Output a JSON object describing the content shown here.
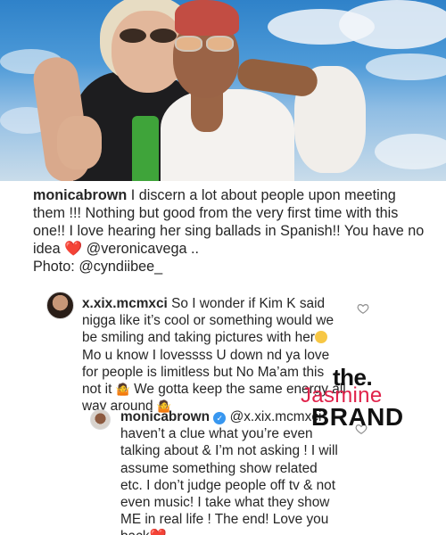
{
  "post": {
    "username": "monicabrown",
    "caption_text": " I discern a lot about people upon meeting them !!! Nothing but good from the very first time with this one!! I love hearing her sing ballads in Spanish!! You have no idea ",
    "caption_mention": "@veronicavega",
    "caption_after": " ..",
    "photo_credit_label": "Photo: ",
    "photo_credit": "@cyndiibee_"
  },
  "comments": [
    {
      "username": "x.xix.mcmxci",
      "text_a": " So I wonder if Kim K said nigga like it’s cool or something would we be smiling and taking pictures with her",
      "text_b": " Mo u know I lovessss U down nd ya love for people is limitless but No Ma’am this not it ",
      "text_c": " We gotta keep the same energy all way around "
    },
    {
      "username": "monicabrown",
      "mention": " @x.xix.mcmxci",
      "text": " haven’t a clue what you’re even talking about & I’m not asking ! I will assume something show related etc. I don’t judge people off tv & not even music! I take what they show ME in real life ! The end! Love you back"
    }
  ],
  "watermark": {
    "line1": "the.",
    "line2": "Jasmine",
    "line3": "BRAND"
  },
  "icons": {
    "heart_emoji": "red-heart-icon",
    "like": "heart-outline-icon",
    "verified": "verified-badge-icon"
  },
  "colors": {
    "text": "#262626",
    "heart": "#e0223c",
    "verified": "#3897f0",
    "watermark_pink": "#e0224a"
  }
}
